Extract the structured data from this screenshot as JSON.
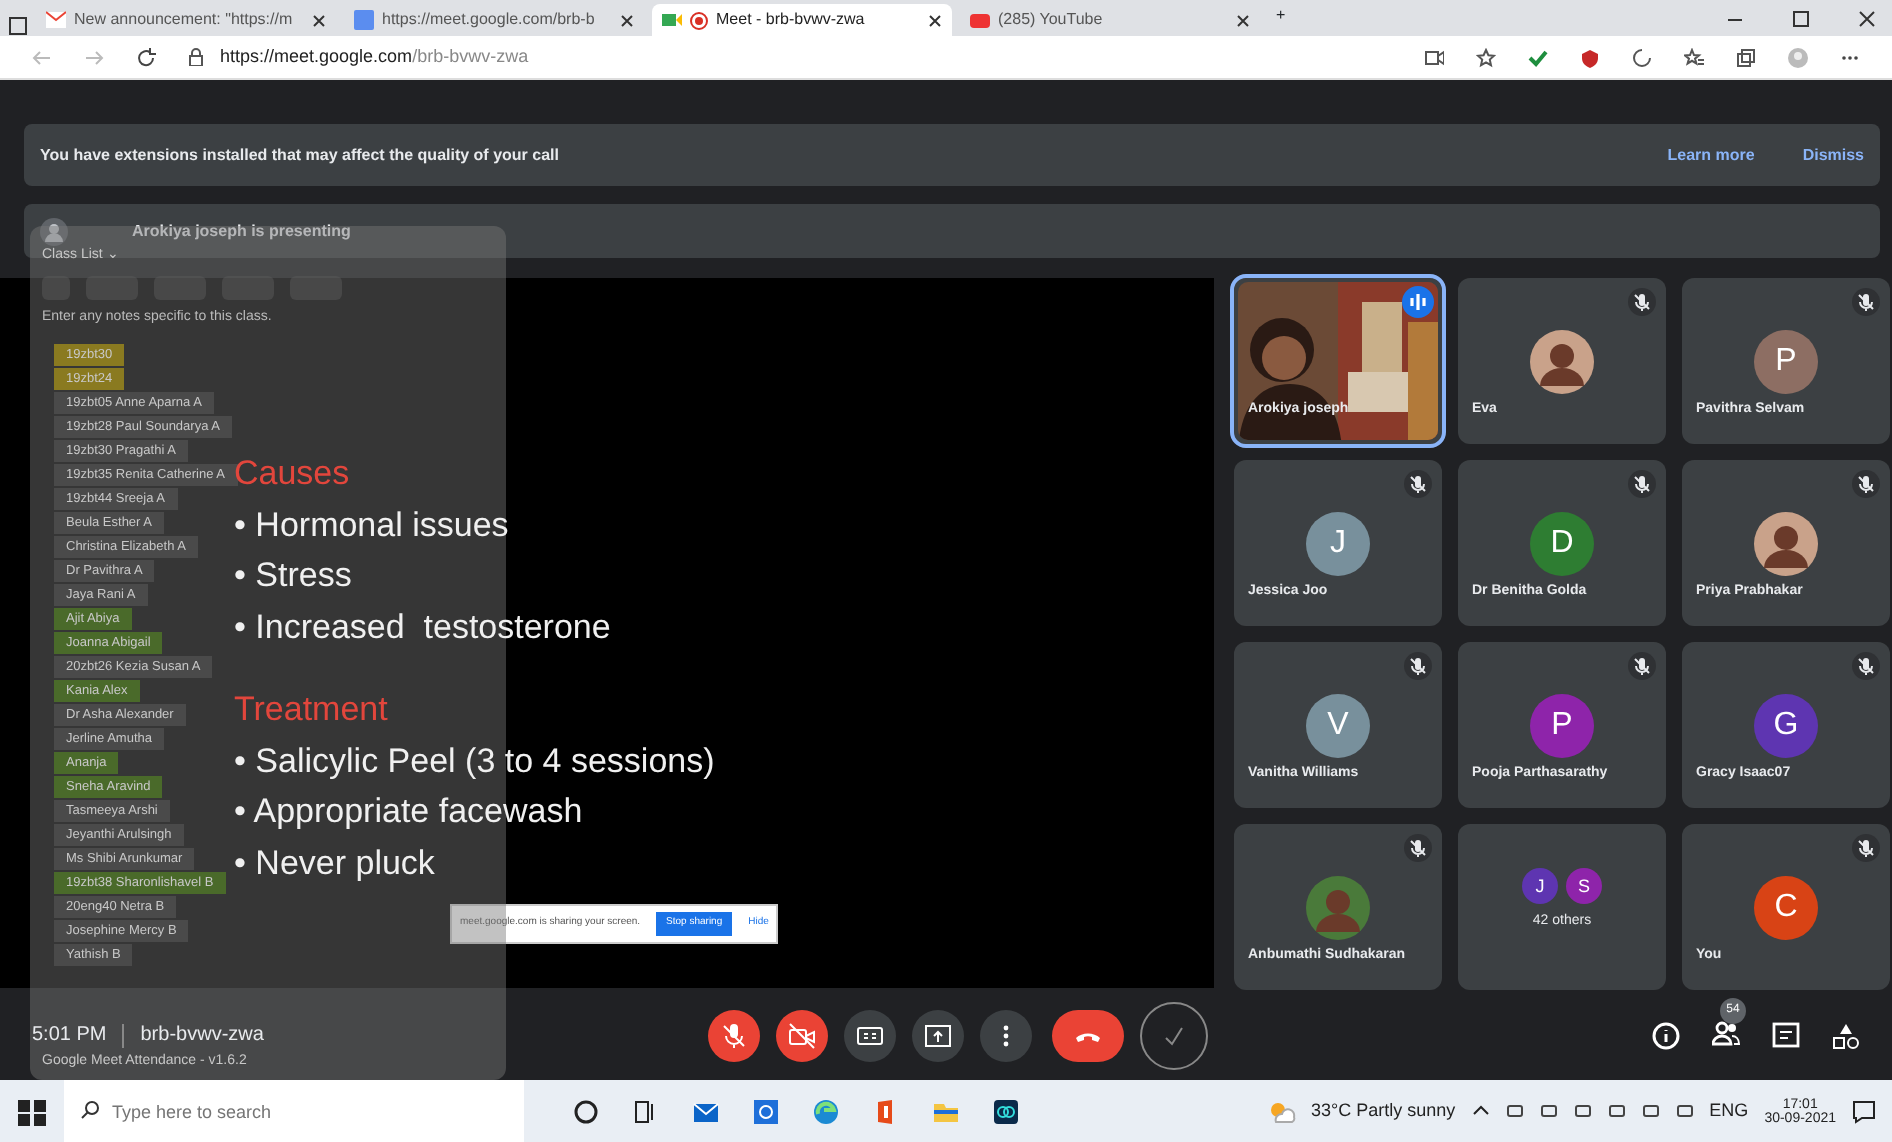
{
  "browser": {
    "tabs": [
      {
        "title": "New announcement: \"https://m",
        "selected": false
      },
      {
        "title": "https://meet.google.com/brb-b",
        "selected": false
      },
      {
        "title": "Meet - brb-bvwv-zwa",
        "selected": true
      },
      {
        "title": "(285) YouTube",
        "selected": false
      }
    ],
    "new_tab": "+",
    "url_host": "https://meet.google.com",
    "url_path": "/brb-bvwv-zwa"
  },
  "banner": {
    "text": "You have extensions installed that may affect the quality of your call",
    "actions": [
      "Learn more",
      "Dismiss"
    ]
  },
  "presenting": "Arokiya joseph is presenting",
  "class_list": {
    "title": "Class List ⌄",
    "notes_placeholder": "Enter any notes specific to this class.",
    "students": [
      {
        "name": "19zbt30",
        "color": "#8a7a20"
      },
      {
        "name": "19zbt24",
        "color": "#8a7a20"
      },
      {
        "name": "19zbt05 Anne Aparna A"
      },
      {
        "name": "19zbt28 Paul Soundarya A"
      },
      {
        "name": "19zbt30 Pragathi A"
      },
      {
        "name": "19zbt35 Renita Catherine A"
      },
      {
        "name": "19zbt44 Sreeja A"
      },
      {
        "name": "Beula Esther A"
      },
      {
        "name": "Christina Elizabeth A"
      },
      {
        "name": "Dr Pavithra A"
      },
      {
        "name": "Jaya Rani A"
      },
      {
        "name": "Ajit Abiya",
        "color": "#4a6a2a"
      },
      {
        "name": "Joanna Abigail",
        "color": "#4a6a2a"
      },
      {
        "name": "20zbt26 Kezia Susan A"
      },
      {
        "name": "Kania Alex",
        "color": "#4a6a2a"
      },
      {
        "name": "Dr Asha Alexander"
      },
      {
        "name": "Jerline Amutha"
      },
      {
        "name": "Ananja",
        "color": "#4a6a2a"
      },
      {
        "name": "Sneha Aravind",
        "color": "#4a6a2a"
      },
      {
        "name": "Tasmeeya Arshi"
      },
      {
        "name": "Jeyanthi Arulsingh"
      },
      {
        "name": "Ms Shibi Arunkumar"
      },
      {
        "name": "19zbt38 Sharonlishavel B",
        "color": "#4a6a2a"
      },
      {
        "name": "20eng40 Netra B"
      },
      {
        "name": "Josephine Mercy B"
      },
      {
        "name": "Yathish B"
      }
    ],
    "footer": "Google Meet Attendance - v1.6.2"
  },
  "slide": {
    "sections": [
      {
        "heading": "Causes",
        "bullets": [
          "• Hormonal issues",
          "• Stress",
          "• Increased  testosterone"
        ]
      },
      {
        "heading": "Treatment",
        "bullets": [
          "• Salicylic Peel (3 to 4 sessions)",
          "• Appropriate facewash",
          "• Never pluck"
        ]
      }
    ]
  },
  "share_notice": {
    "text": "meet.google.com is sharing your screen.",
    "stop": "Stop sharing",
    "hide": "Hide"
  },
  "tiles": [
    {
      "name": "Arokiya joseph",
      "kind": "video",
      "muted": false,
      "selected": true
    },
    {
      "name": "Eva",
      "muted": true,
      "selected": false
    },
    {
      "name": "Pavithra Selvam",
      "kind": "initial",
      "initial": "P",
      "color": "#8d6e63",
      "muted": true,
      "selected": false
    },
    {
      "name": "Jessica Joo",
      "kind": "initial",
      "initial": "J",
      "color": "#78909c",
      "muted": true,
      "selected": false
    },
    {
      "name": "Dr Benitha Golda",
      "kind": "initial",
      "initial": "D",
      "color": "#2e7d32",
      "muted": true,
      "selected": false
    },
    {
      "name": "Priya Prabhakar",
      "muted": true,
      "selected": false
    },
    {
      "name": "Vanitha Williams",
      "kind": "initial",
      "initial": "V",
      "color": "#78909c",
      "muted": true,
      "selected": false
    },
    {
      "name": "Pooja Parthasarathy",
      "kind": "initial",
      "initial": "P",
      "color": "#8e24aa",
      "muted": true,
      "selected": false
    },
    {
      "name": "Gracy Isaac07",
      "kind": "initial",
      "initial": "G",
      "color": "#5e35b1",
      "muted": true,
      "selected": false
    },
    {
      "name": "Anbumathi Sudhakaran",
      "muted": true,
      "selected": false
    },
    {
      "name": "42 others",
      "kind": "others",
      "initials": [
        {
          "letter": "J",
          "color": "#5e35b1"
        },
        {
          "letter": "S",
          "color": "#8e24aa"
        }
      ],
      "muted": false,
      "selected": false
    },
    {
      "name": "You",
      "kind": "initial",
      "initial": "C",
      "color": "#d84315",
      "muted": true,
      "selected": false
    }
  ],
  "meeting": {
    "time": "5:01 PM",
    "code": "brb-bvwv-zwa"
  },
  "controls": [
    {
      "kind": "mic-off"
    },
    {
      "kind": "cam-off"
    },
    {
      "kind": "captions"
    },
    {
      "kind": "present"
    },
    {
      "kind": "more"
    },
    {
      "kind": "end"
    },
    {
      "kind": "check"
    }
  ],
  "people_count": "54",
  "taskbar": {
    "search_placeholder": "Type here to search",
    "weather": "33°C Partly sunny",
    "language": "ENG",
    "time": "17:01",
    "date": "30-09-2021"
  }
}
